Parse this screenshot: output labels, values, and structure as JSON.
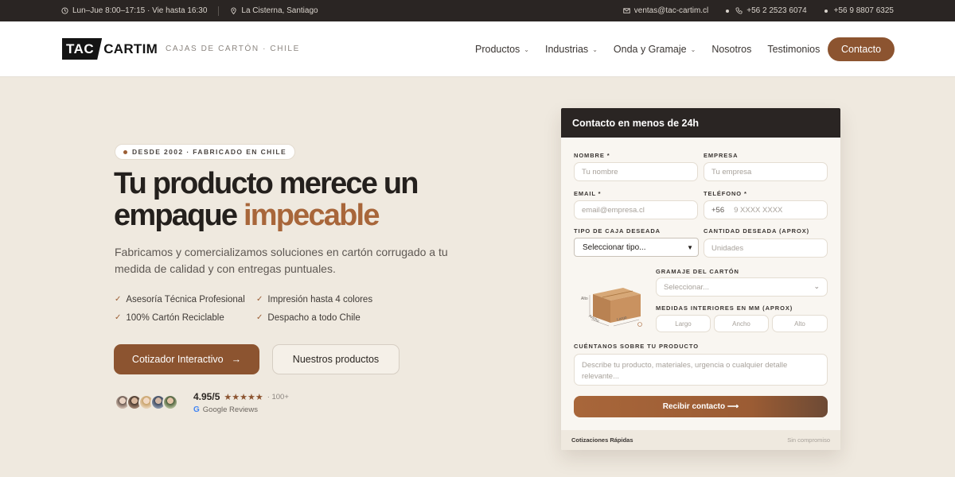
{
  "topbar": {
    "hours": "Lun–Jue 8:00–17:15 · Vie hasta 16:30",
    "location": "La Cisterna, Santiago",
    "email": "ventas@tac-cartim.cl",
    "phone1": "+56 2 2523 6074",
    "phone2": "+56 9 8807 6325"
  },
  "header": {
    "logo_tac": "TAC",
    "logo_cartim": "CARTIM",
    "tagline": "CAJAS DE CARTÓN · CHILE",
    "nav": [
      {
        "label": "Productos"
      },
      {
        "label": "Industrias"
      },
      {
        "label": "Onda y Gramaje"
      },
      {
        "label": "Nosotros"
      },
      {
        "label": "Testimonios"
      }
    ],
    "contact_label": "Contacto"
  },
  "hero": {
    "badge": "DESDE 2002 · FABRICADO EN CHILE",
    "title_line1": "Tu producto merece un",
    "title_line2_a": "empaque ",
    "title_line2_b": "impecable",
    "lead": "Fabricamos y comercializamos soluciones en cartón corrugado a tu medida de calidad y con entregas puntuales.",
    "features": [
      "Asesoría Técnica Profesional",
      "Impresión hasta 4 colores",
      "100% Cartón Reciclable",
      "Despacho a todo Chile"
    ],
    "primary_cta": "Cotizador Interactivo",
    "secondary_cta": "Nuestros productos",
    "rating": "4.95/5",
    "stars": "★★★★★",
    "review_count": "· 100+",
    "review_source": "Google Reviews"
  },
  "form": {
    "title": "Contacto en menos de 24h",
    "name_label": "NOMBRE *",
    "name_placeholder": "Tu nombre",
    "company_label": "EMPRESA",
    "company_placeholder": "Tu empresa",
    "email_label": "EMAIL *",
    "email_placeholder": "email@empresa.cl",
    "phone_label": "TELÉFONO *",
    "phone_prefix": "+56",
    "phone_placeholder": "9 XXXX XXXX",
    "box_type_label": "TIPO DE CAJA DESEADA",
    "box_type_value": "Seleccionar tipo...",
    "quantity_label": "CANTIDAD DESEADA (APROX)",
    "quantity_placeholder": "Unidades",
    "gramaje_label": "GRAMAJE DEL CARTÓN",
    "gramaje_value": "Seleccionar...",
    "measures_label": "MEDIDAS INTERIORES EN MM (APROX)",
    "largo_placeholder": "Largo",
    "ancho_placeholder": "Ancho",
    "alto_placeholder": "Alto",
    "box_labels": {
      "alto": "Alto",
      "ancho": "Ancho",
      "largo": "Largo"
    },
    "description_label": "CUÉNTANOS SOBRE TU PRODUCTO",
    "description_placeholder": "Describe tu producto, materiales, urgencia o cualquier detalle relevante...",
    "submit_label": "Recibir contacto ⟶",
    "footer_left": "Cotizaciones Rápidas",
    "footer_right": "Sin compromiso"
  },
  "colors": {
    "accent": "#8c5430",
    "accent_text": "#a8663a",
    "dark": "#2a2523",
    "background": "#efe9df"
  }
}
